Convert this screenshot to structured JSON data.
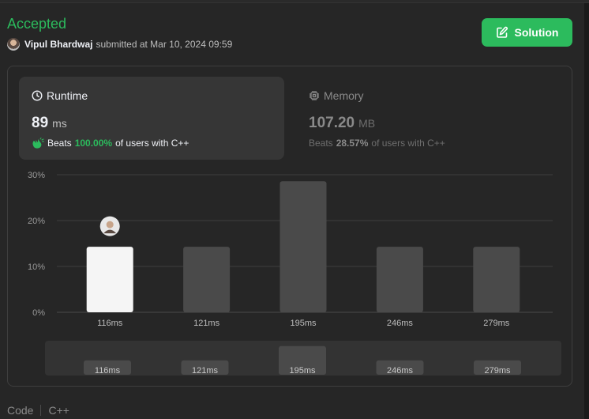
{
  "status": {
    "title": "Accepted"
  },
  "submission": {
    "author": "Vipul Bhardwaj",
    "meta": "submitted at Mar 10, 2024 09:59"
  },
  "actions": {
    "solution_label": "Solution"
  },
  "runtime": {
    "label": "Runtime",
    "value": "89",
    "unit": "ms",
    "beats_prefix": "Beats",
    "beats_pct": "100.00%",
    "beats_suffix": "of users with C++"
  },
  "memory": {
    "label": "Memory",
    "value": "107.20",
    "unit": "MB",
    "beats_prefix": "Beats",
    "beats_pct": "28.57%",
    "beats_suffix": "of users with C++"
  },
  "colors": {
    "accepted": "#2cbb5d",
    "bar_active": "#f5f5f5",
    "bar_inactive": "#4a4a4a"
  },
  "chart_data": {
    "type": "bar",
    "categories": [
      "116ms",
      "121ms",
      "195ms",
      "246ms",
      "279ms"
    ],
    "values": [
      14.29,
      14.29,
      28.57,
      14.29,
      14.29
    ],
    "highlight_index": 0,
    "yticks": [
      "30%",
      "20%",
      "10%",
      "0%"
    ],
    "ylim": [
      0,
      30
    ],
    "grid": true,
    "xlabel": "",
    "ylabel": "",
    "title": ""
  },
  "range_labels": [
    "116ms",
    "121ms",
    "195ms",
    "246ms",
    "279ms"
  ],
  "footer": {
    "tab_code": "Code",
    "tab_lang": "C++"
  }
}
